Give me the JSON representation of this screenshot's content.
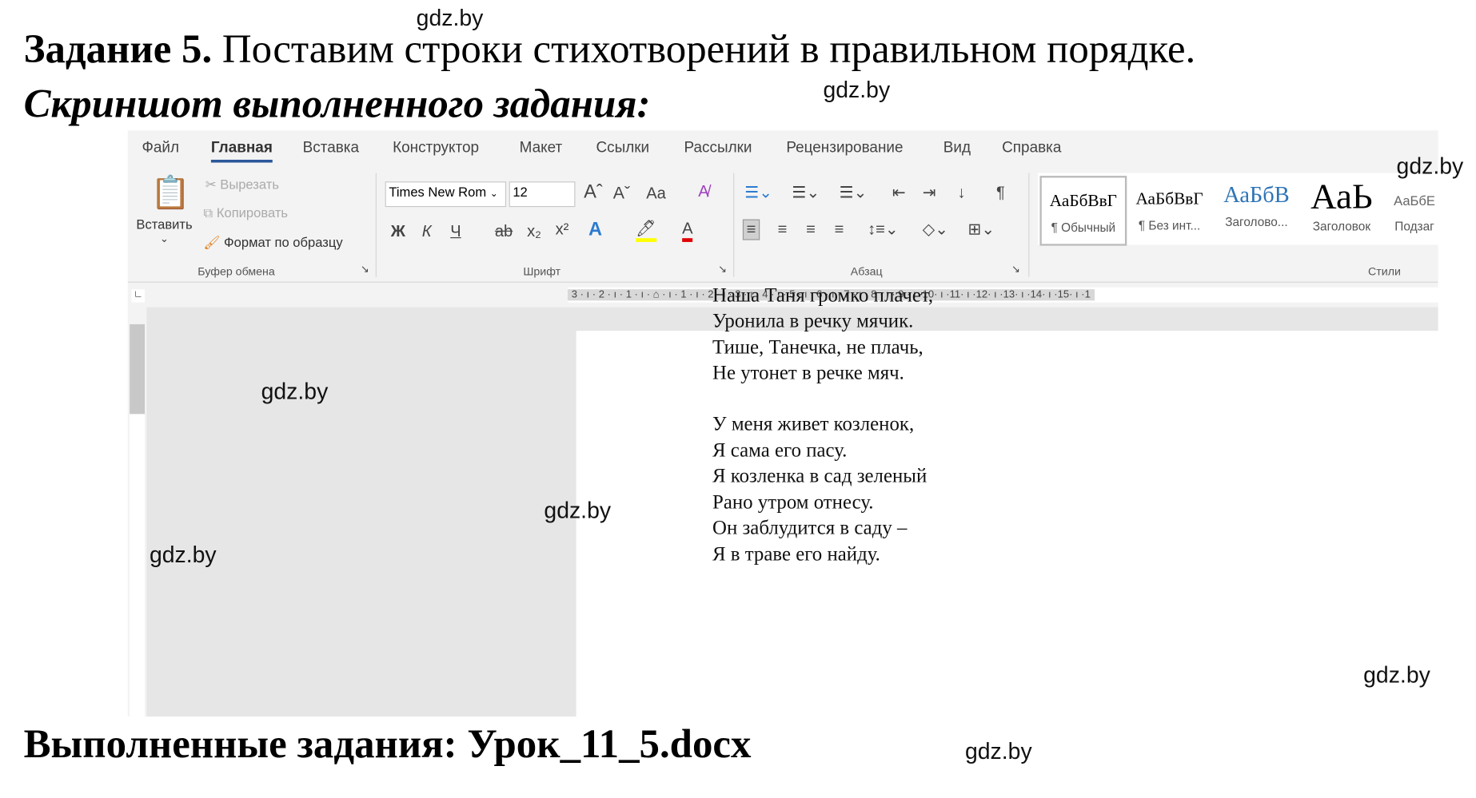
{
  "task": {
    "title_bold": "Задание 5.",
    "title_rest": "Поставим строки стихотворений в правильном порядке.",
    "subtitle": "Скриншот выполненного задания:",
    "footer": "Выполненные задания: Урок_11_5.docx"
  },
  "watermark": "gdz.by",
  "word": {
    "tabs": [
      "Файл",
      "Главная",
      "Вставка",
      "Конструктор",
      "Макет",
      "Ссылки",
      "Рассылки",
      "Рецензирование",
      "Вид",
      "Справка"
    ],
    "active_tab": "Главная",
    "clipboard": {
      "paste": "Вставить",
      "cut": "Вырезать",
      "copy": "Копировать",
      "format_painter": "Формат по образцу",
      "label": "Буфер обмена"
    },
    "font": {
      "name": "Times New Rom",
      "size": "12",
      "label": "Шрифт",
      "bold": "Ж",
      "italic": "К",
      "underline": "Ч",
      "strike": "ab",
      "sub": "x₂",
      "sup": "x²",
      "case": "Aa"
    },
    "paragraph": {
      "label": "Абзац"
    },
    "styles": {
      "label": "Стили",
      "items": [
        {
          "preview": "АаБбВвГ",
          "name": "¶ Обычный"
        },
        {
          "preview": "АаБбВвГ",
          "name": "¶ Без инт..."
        },
        {
          "preview": "АаБбВ",
          "name": "Заголово..."
        },
        {
          "preview": "АаЬ",
          "name": "Заголовок"
        },
        {
          "preview": "АаБбЕ",
          "name": "Подзаг"
        }
      ]
    },
    "ruler": "3 · ı · 2 · ı · 1 · ı · ⌂ · ı · 1 · ı · 2 · ı · 3 · ı · 4 · ı · 5 · ı · 6 · ı · 7 · ı · 8 · ı · 9 · ı ·10· ı ·11· ı ·12· ı ·13· ı ·14· ı ·15· ı ·1",
    "colors": {
      "accent": "#2b579a",
      "highlight": "#ffff00",
      "font_color": "#e00000"
    }
  },
  "poem": [
    "Наша Таня громко плачет,",
    "Уронила в речку мячик.",
    "Тише, Танечка, не плачь,",
    "Не утонет в речке мяч.",
    "",
    "У меня живет козленок,",
    "Я сама его пасу.",
    "Я козленка в сад зеленый",
    "Рано утром отнесу.",
    "Он заблудится в саду –",
    "Я в траве его найду."
  ]
}
